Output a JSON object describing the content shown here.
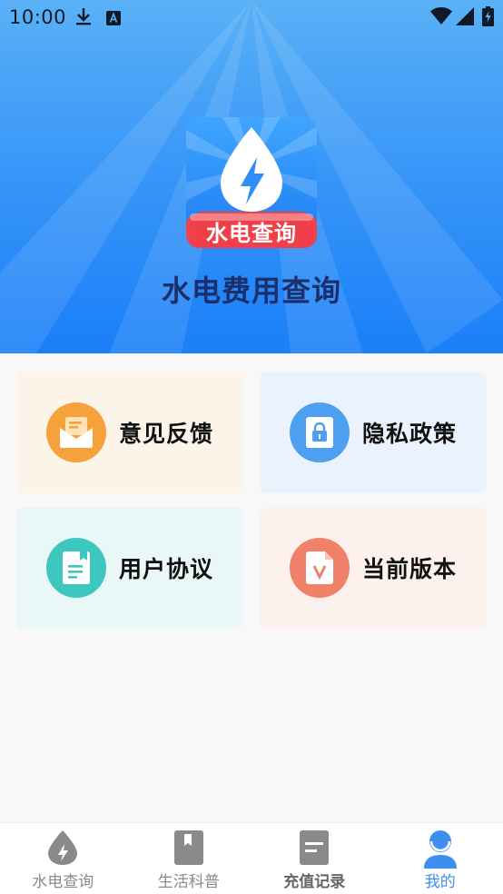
{
  "status_bar": {
    "time": "10:00",
    "icons": [
      "download-icon",
      "keyboard-a-icon",
      "wifi-icon",
      "signal-icon",
      "battery-icon"
    ]
  },
  "header": {
    "app_icon_label": "水电查询",
    "title": "水电费用查询",
    "gradient": [
      "#5ab1f6",
      "#1a7ff9"
    ]
  },
  "menu": [
    {
      "label": "意见反馈",
      "icon": "mail-icon",
      "bg": "#fdf4e9",
      "icon_color": "#f5a23a"
    },
    {
      "label": "隐私政策",
      "icon": "lock-icon",
      "bg": "#eaf3fd",
      "icon_color": "#4d9ff0"
    },
    {
      "label": "用户协议",
      "icon": "document-icon",
      "bg": "#e9f7f6",
      "icon_color": "#3cc7bf"
    },
    {
      "label": "当前版本",
      "icon": "version-file-icon",
      "bg": "#fdf1ee",
      "icon_color": "#ef8169"
    }
  ],
  "tabbar": {
    "active_color": "#3c8ef0",
    "inactive_color": "#8a8a8a",
    "tabs": [
      {
        "label": "水电查询",
        "icon": "water-drop-bolt-icon",
        "active": false
      },
      {
        "label": "生活科普",
        "icon": "book-icon",
        "active": false
      },
      {
        "label": "充值记录",
        "icon": "record-list-icon",
        "active": false
      },
      {
        "label": "我的",
        "icon": "user-icon",
        "active": true
      }
    ]
  }
}
